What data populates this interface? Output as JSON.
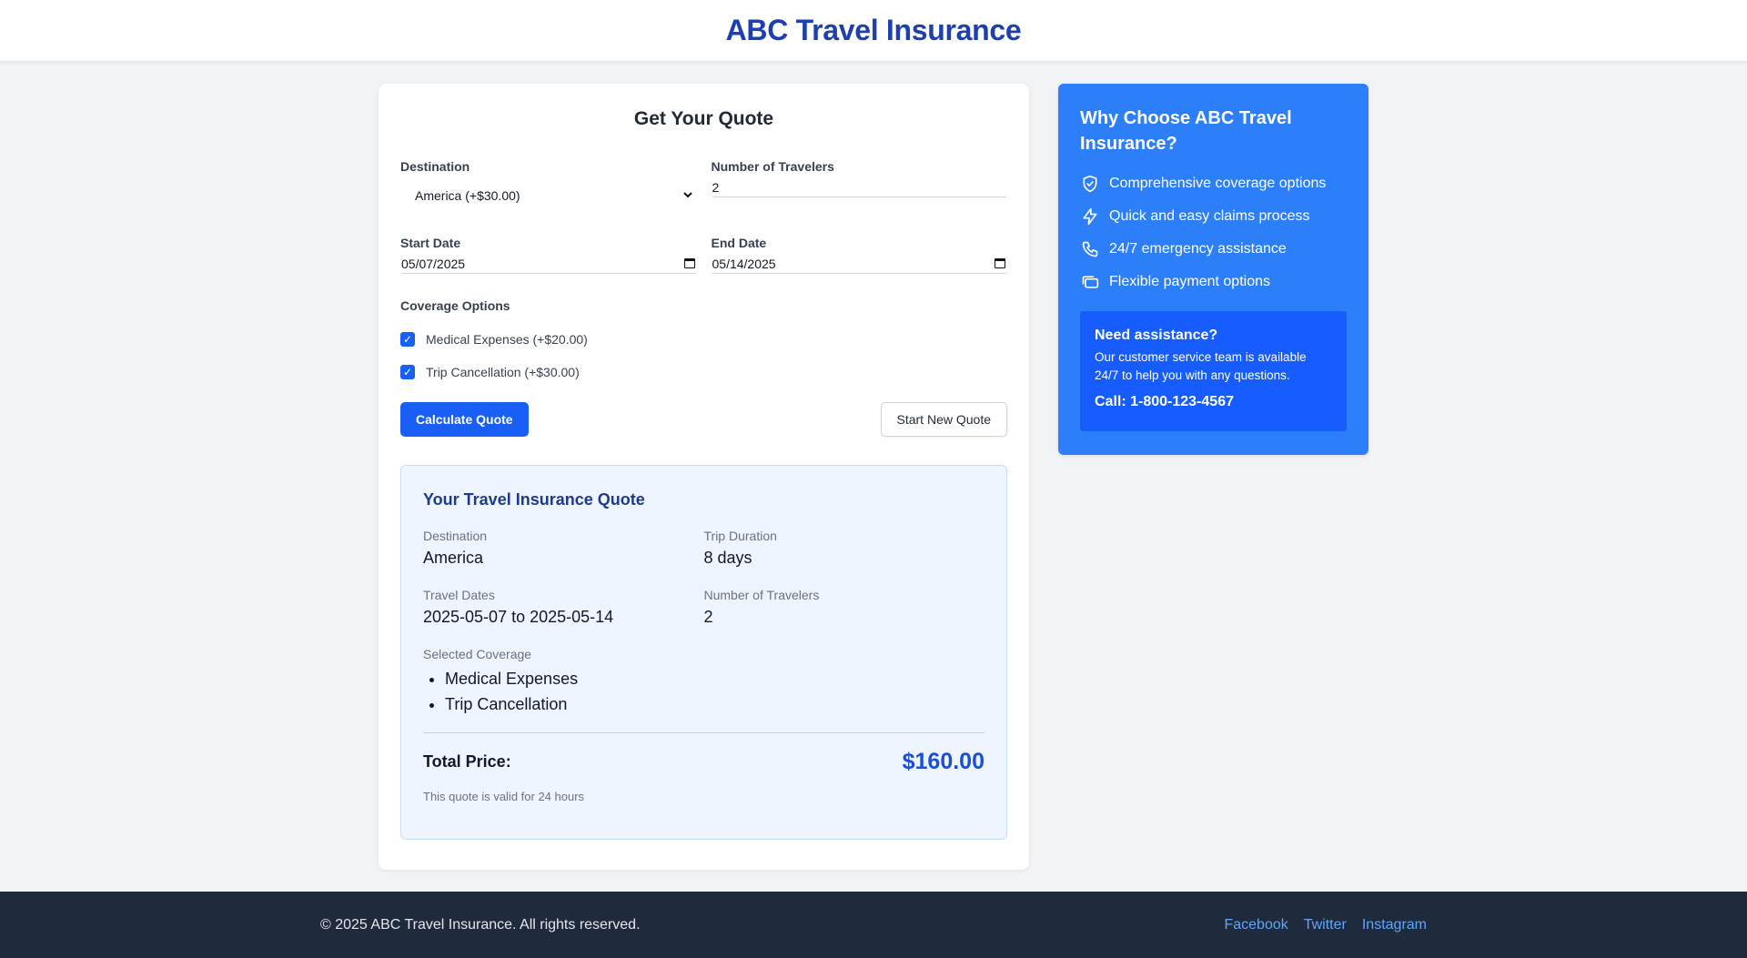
{
  "header": {
    "title": "ABC Travel Insurance"
  },
  "form": {
    "title": "Get Your Quote",
    "destination_label": "Destination",
    "destination_value": "America (+$30.00)",
    "travelers_label": "Number of Travelers",
    "travelers_value": "2",
    "start_label": "Start Date",
    "start_value": "05/07/2025",
    "end_label": "End Date",
    "end_value": "05/14/2025",
    "coverage_label": "Coverage Options",
    "coverage_options": [
      {
        "label": "Medical Expenses (+$20.00)",
        "checked": true
      },
      {
        "label": "Trip Cancellation (+$30.00)",
        "checked": true
      }
    ],
    "calculate_label": "Calculate Quote",
    "new_quote_label": "Start New Quote"
  },
  "result": {
    "title": "Your Travel Insurance Quote",
    "destination_label": "Destination",
    "destination_value": "America",
    "duration_label": "Trip Duration",
    "duration_value": "8 days",
    "dates_label": "Travel Dates",
    "dates_value": "2025-05-07 to 2025-05-14",
    "travelers_label": "Number of Travelers",
    "travelers_value": "2",
    "coverage_label": "Selected Coverage",
    "coverage_items": [
      "Medical Expenses",
      "Trip Cancellation"
    ],
    "total_label": "Total Price:",
    "total_value": "$160.00",
    "valid_note": "This quote is valid for 24 hours"
  },
  "why": {
    "title": "Why Choose ABC Travel Insurance?",
    "items": [
      {
        "icon": "shield-check-icon",
        "label": "Comprehensive coverage options"
      },
      {
        "icon": "lightning-icon",
        "label": "Quick and easy claims process"
      },
      {
        "icon": "phone-icon",
        "label": "24/7 emergency assistance"
      },
      {
        "icon": "cards-icon",
        "label": "Flexible payment options"
      }
    ],
    "assist_title": "Need assistance?",
    "assist_text": "Our customer service team is available 24/7 to help you with any questions.",
    "assist_call": "Call: 1-800-123-4567"
  },
  "footer": {
    "copyright": "© 2025 ABC Travel Insurance. All rights reserved.",
    "links": [
      "Facebook",
      "Twitter",
      "Instagram"
    ]
  },
  "colors": {
    "brand": "#1e40af",
    "primary_button": "#1a5ff5",
    "sidebar_bg": "#2d7ff9",
    "assist_bg": "#175cff",
    "footer_bg": "#1f2a3c",
    "link": "#60a5fa"
  }
}
